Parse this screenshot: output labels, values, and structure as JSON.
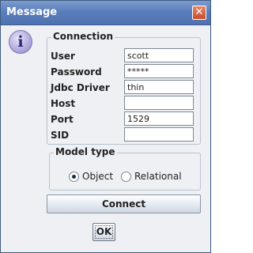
{
  "window": {
    "title": "Message",
    "close_glyph": "✕",
    "info_glyph": "i"
  },
  "connection": {
    "title": "Connection",
    "fields": [
      {
        "label": "User",
        "value": "scott"
      },
      {
        "label": "Password",
        "value": "*****"
      },
      {
        "label": "Jdbc Driver",
        "value": "thin"
      },
      {
        "label": "Host",
        "value": ""
      },
      {
        "label": "Port",
        "value": "1529"
      },
      {
        "label": "SID",
        "value": ""
      }
    ]
  },
  "model_type": {
    "title": "Model type",
    "options": [
      {
        "label": "Object",
        "selected": true
      },
      {
        "label": "Relational",
        "selected": false
      }
    ]
  },
  "buttons": {
    "connect": "Connect",
    "ok": "OK"
  },
  "colors": {
    "titlebar": "#5b7fbc",
    "close_button": "#c84a2a",
    "dialog_background": "#eef0f3"
  },
  "icons": {
    "dialog": "info-icon",
    "close": "close-icon"
  }
}
